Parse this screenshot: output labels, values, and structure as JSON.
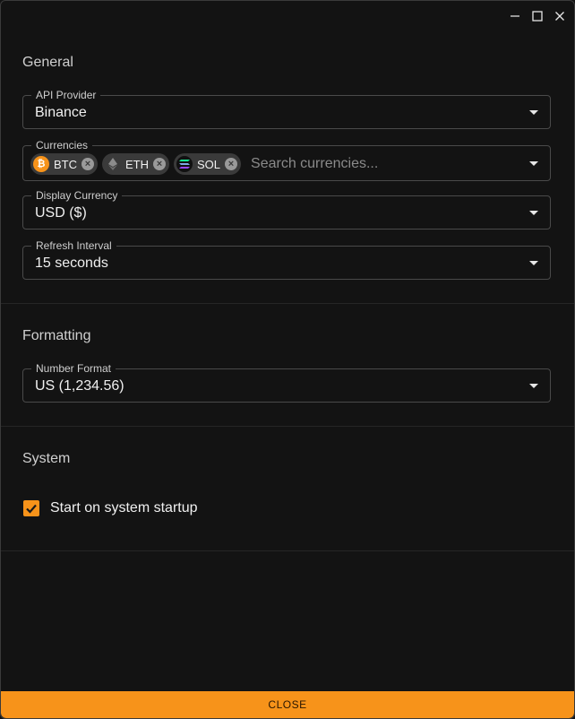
{
  "window": {
    "controls": [
      "minimize-icon",
      "maximize-icon",
      "close-icon"
    ]
  },
  "general": {
    "title": "General",
    "api_provider": {
      "label": "API Provider",
      "value": "Binance"
    },
    "currencies": {
      "label": "Currencies",
      "chips": [
        {
          "label": "BTC",
          "icon": "bitcoin-icon",
          "color": "#f7931a"
        },
        {
          "label": "ETH",
          "icon": "ethereum-icon",
          "color": "#9a9a9a"
        },
        {
          "label": "SOL",
          "icon": "solana-icon",
          "color": "#14f195"
        }
      ],
      "placeholder": "Search currencies..."
    },
    "display_currency": {
      "label": "Display Currency",
      "value": "USD ($)"
    },
    "refresh_interval": {
      "label": "Refresh Interval",
      "value": "15 seconds"
    }
  },
  "formatting": {
    "title": "Formatting",
    "number_format": {
      "label": "Number Format",
      "value": "US (1,234.56)"
    }
  },
  "system": {
    "title": "System",
    "start_on_startup": {
      "label": "Start on system startup",
      "checked": true
    }
  },
  "footer": {
    "close_label": "CLOSE"
  },
  "colors": {
    "accent": "#f7931a",
    "background": "#131313",
    "border": "#4a4a4a"
  }
}
